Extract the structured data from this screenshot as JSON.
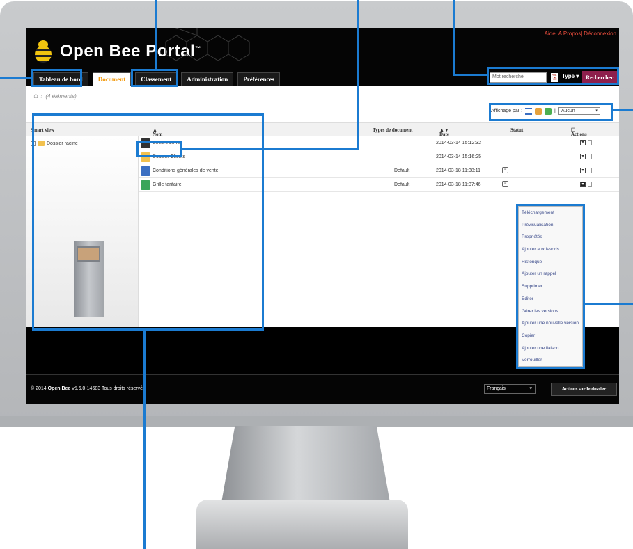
{
  "app": {
    "brand": "Open Bee Portal",
    "brand_tm": "™",
    "top_links": [
      "Aide",
      "A Propos",
      "Déconnexion"
    ],
    "tabs": [
      {
        "label": "Tableau de bord"
      },
      {
        "label": "Document"
      },
      {
        "label": "Classement"
      },
      {
        "label": "Administration"
      },
      {
        "label": "Préférences"
      }
    ],
    "active_tab": "Document",
    "search": {
      "placeholder": "Mot recherché",
      "type_label": "Type",
      "button": "Rechercher"
    }
  },
  "breadcrumb": {
    "count": "(4 éléments)"
  },
  "view": {
    "label": "Affichage par :",
    "select": "Aucun"
  },
  "table": {
    "side_header": "Smart view",
    "columns": [
      "Nom",
      "Types de document",
      "Date",
      "Statut",
      "Actions"
    ],
    "sidebar_root": "Dossier racine",
    "rows": [
      {
        "name": "Secure zone",
        "type": "",
        "date": "2014-03-14 15:12:32",
        "icon": "safe-icon"
      },
      {
        "name": "Dossier Clients",
        "type": "",
        "date": "2014-03-14 15:16:25",
        "icon": "folder-icon"
      },
      {
        "name": "Conditions générales de vente",
        "type": "Default",
        "date": "2014-03-18 11:38:11",
        "icon": "word-document-icon"
      },
      {
        "name": "Grille tarifaire",
        "type": "Default",
        "date": "2014-03-18 11:37:46",
        "icon": "excel-document-icon"
      }
    ]
  },
  "context_menu": [
    "Téléchargement",
    "Prévisualisation",
    "Propriétés",
    "Ajouter aux favoris",
    "Historique",
    "Ajouter un rappel",
    "Supprimer",
    "Editer",
    "Gérer les versions",
    "Ajouter une nouvelle version",
    "Copier",
    "Ajouter une liaison",
    "Verrouiller"
  ],
  "footer": {
    "copyright_prefix": "© 2014 ",
    "copyright_brand": "Open Bee",
    "copyright_suffix": " v5.6.0-14683 Tous droits réservés.",
    "language": "Français",
    "folder_actions": "Actions sur le dossier"
  },
  "colors": {
    "callout": "#1b7bd1",
    "accent": "#f39c12",
    "search_button": "#8e1f4c"
  }
}
